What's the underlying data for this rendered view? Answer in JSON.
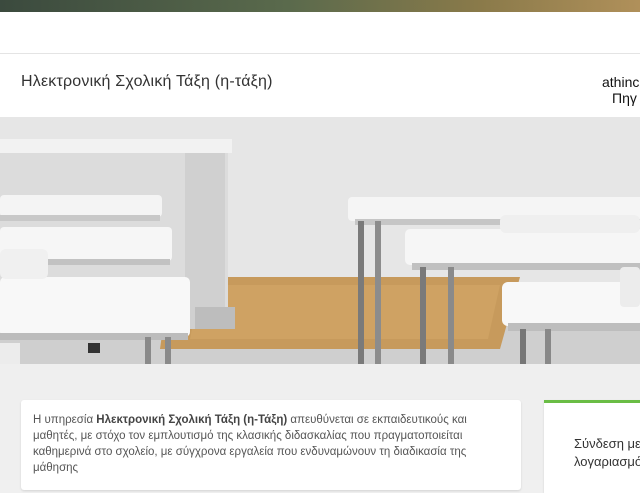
{
  "header": {
    "site_title": "Ηλεκτρονική Σχολική Τάξη (η-τάξη)",
    "right_line1": "athinc",
    "right_line2": "Πηγ"
  },
  "intro": {
    "text_before": "Η υπηρεσία ",
    "text_bold": "Ηλεκτρονική Σχολική Τάξη (η-Τάξη)",
    "text_after": " απευθύνεται σε εκπαιδευτικούς και μαθητές, με στόχο τον εμπλουτισμό της κλασικής διδασκαλίας που πραγματοποιείται καθημερινά στο σχολείο, με σύγχρονα εργαλεία που ενδυναμώνουν τη διαδικασία της μάθησης"
  },
  "login": {
    "title_line1": "Σύνδεση με",
    "title_line2": "λογαριασμό"
  },
  "colors": {
    "accent_green": "#6abd45"
  }
}
